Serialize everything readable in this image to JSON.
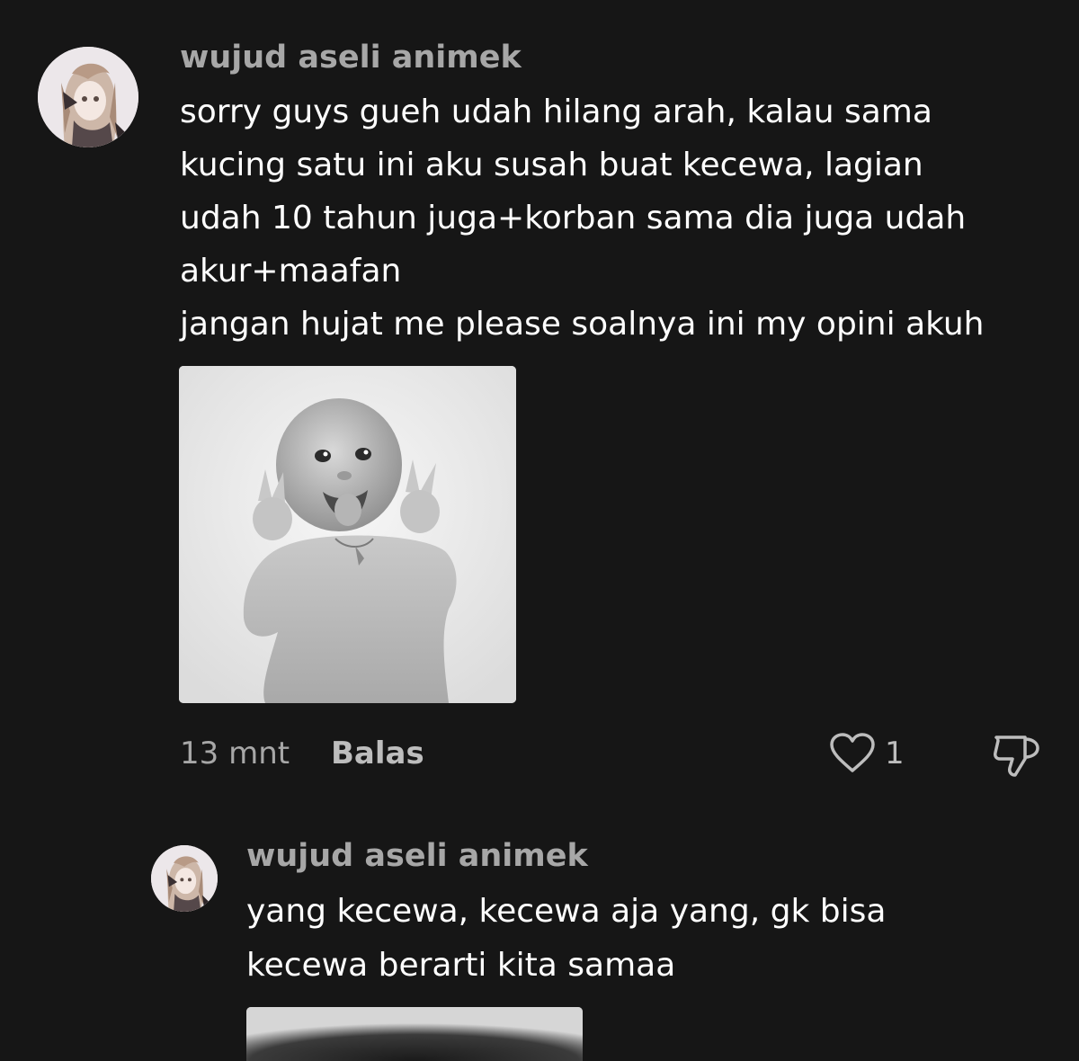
{
  "comments": [
    {
      "username": "wujud aseli animek",
      "lines": [
        "sorry guys gueh udah hilang arah, kalau sama",
        "kucing satu ini aku susah buat kecewa, lagian",
        "udah 10 tahun juga+korban sama dia juga udah",
        "akur+maafan",
        "jangan hujat me please soalnya ini my opini akuh"
      ],
      "time": "13 mnt",
      "reply_label": "Balas",
      "like_count": "1",
      "icons": {
        "avatar": "anime-avatar",
        "like": "heart-icon",
        "dislike": "thumbs-down-icon"
      }
    }
  ],
  "replies": [
    {
      "username": "wujud aseli animek",
      "lines": [
        "yang kecewa, kecewa aja yang, gk bisa",
        "kecewa berarti kita samaa"
      ],
      "icons": {
        "avatar": "anime-avatar"
      }
    }
  ],
  "colors": {
    "background": "#161616",
    "username": "#a7a7a7",
    "body_text": "#ffffff",
    "meta": "#a7a7a7"
  }
}
